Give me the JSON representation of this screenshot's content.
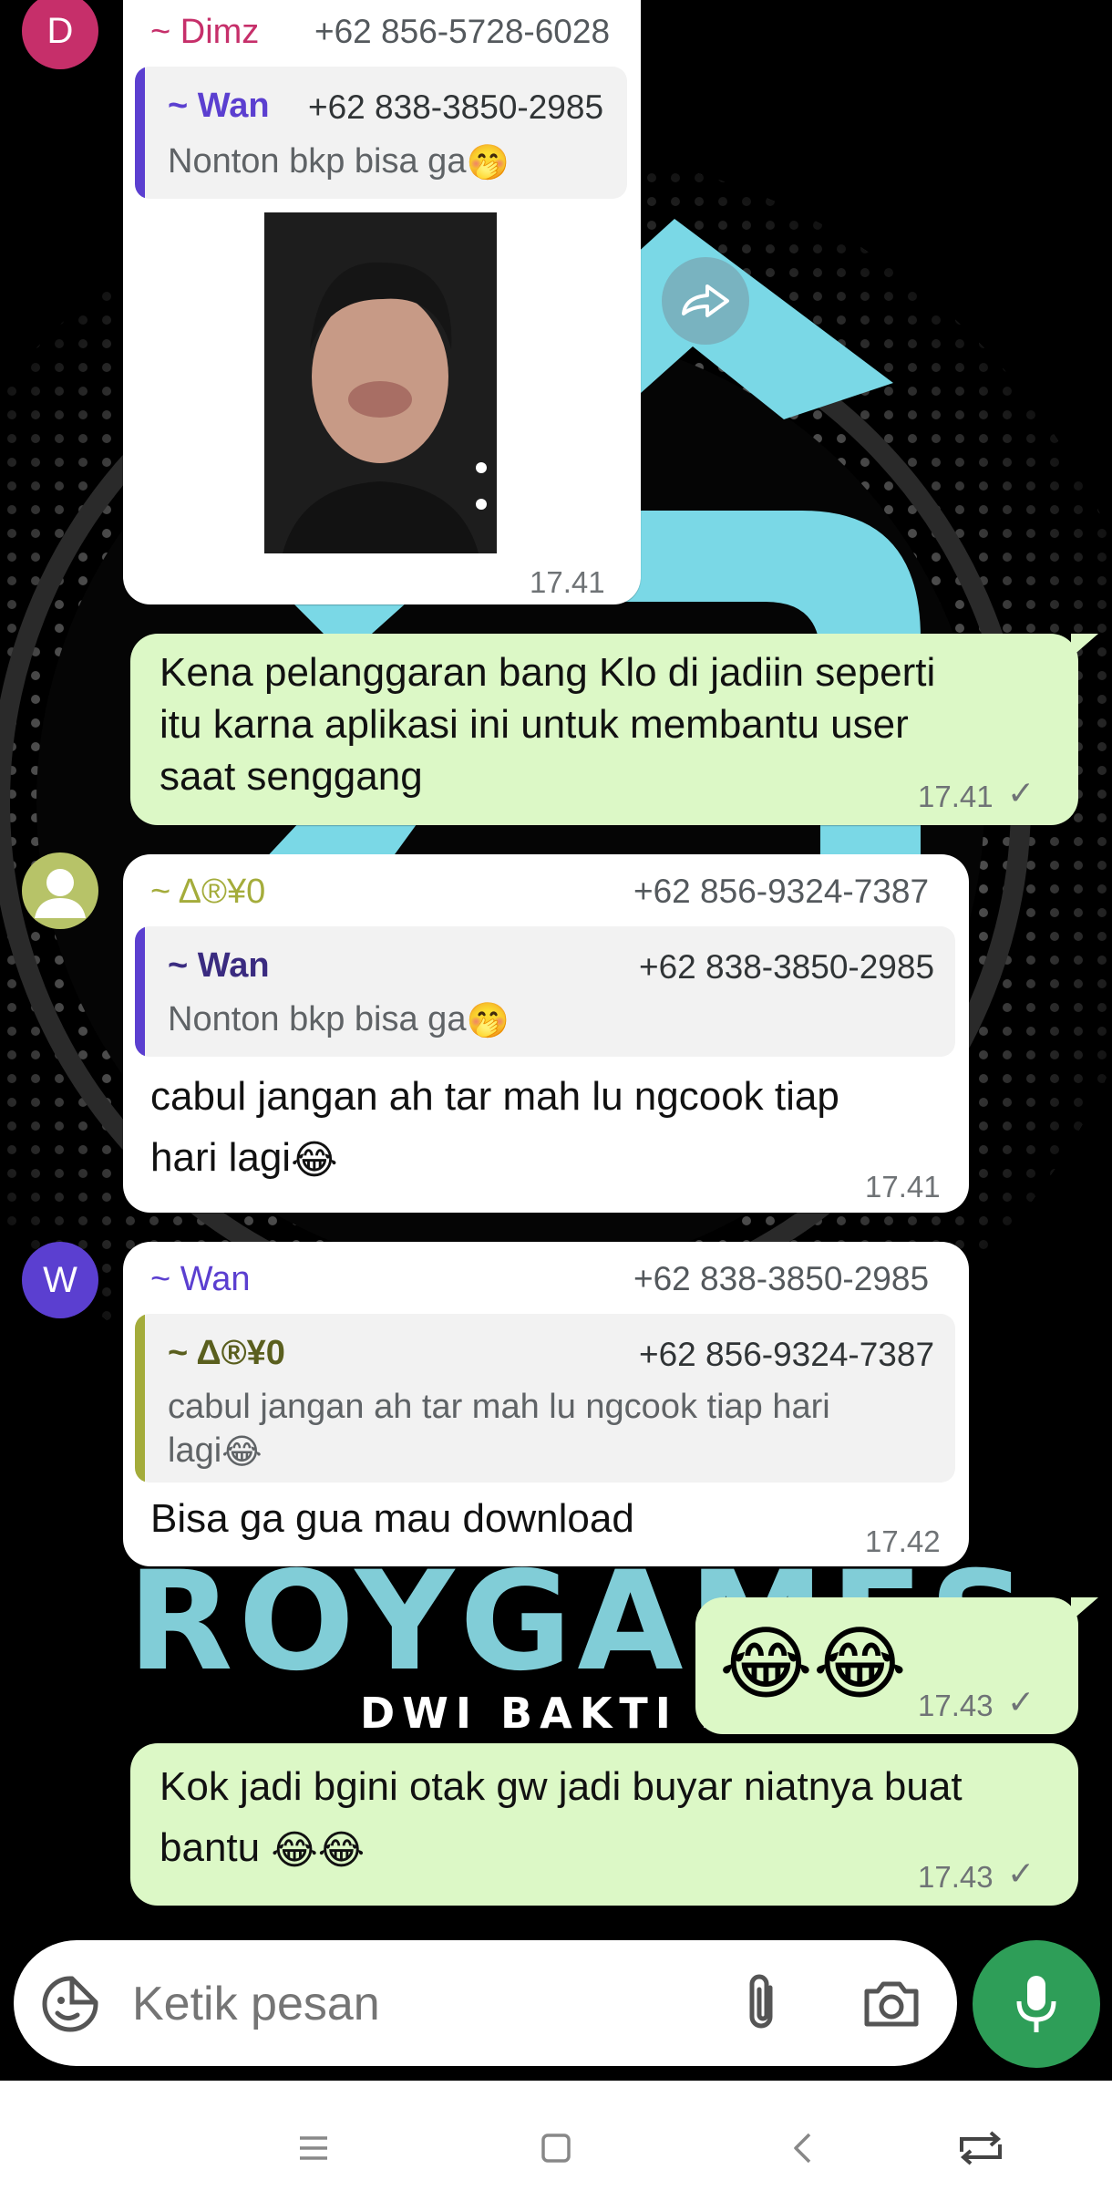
{
  "colors": {
    "incoming_bubble": "#ffffff",
    "outgoing_bubble": "#dcf8c6",
    "accent_green": "#2e9e58",
    "dimz_name": "#c62f6a",
    "wan_name": "#5b3fd0",
    "delta_name": "#a4ac3b"
  },
  "wallpaper": {
    "banner_title": "ROYGAMES",
    "banner_subtitle": "DWI BAKTI N"
  },
  "messages": [
    {
      "avatar_letter": "D",
      "sender": "~ Dimz",
      "phone": "+62 856-5728-6028",
      "quote": {
        "sender": "~ Wan",
        "phone": "+62 838-3850-2985",
        "text": "Nonton bkp bisa ga"
      },
      "media": "video-thumbnail",
      "time": "17.41"
    },
    {
      "text_lines": [
        "Kena pelanggaran bang Klo di jadiin seperti",
        "itu karna aplikasi ini untuk membantu user",
        "saat senggang"
      ],
      "time": "17.41"
    },
    {
      "sender": "~ Δ®¥0",
      "phone": "+62 856-9324-7387",
      "quote": {
        "sender": "~ Wan",
        "phone": "+62 838-3850-2985",
        "text": "Nonton bkp bisa ga"
      },
      "text_lines": [
        "cabul jangan ah tar mah lu ngcook tiap",
        "hari lagi"
      ],
      "time": "17.41"
    },
    {
      "avatar_letter": "W",
      "sender": "~ Wan",
      "phone": "+62 838-3850-2985",
      "quote": {
        "sender": "~ Δ®¥0",
        "phone": "+62 856-9324-7387",
        "text_lines": [
          "cabul jangan ah tar mah lu ngcook tiap hari",
          "lagi"
        ]
      },
      "text": "Bisa ga gua mau download",
      "time": "17.42"
    },
    {
      "emoji_only": "😂😂",
      "time": "17.43"
    },
    {
      "text_lines": [
        "Kok jadi bgini otak gw jadi buyar niatnya buat",
        "bantu "
      ],
      "time": "17.43"
    }
  ],
  "composer": {
    "placeholder": "Ketik pesan",
    "icons": [
      "sticker-icon",
      "paperclip-icon",
      "camera-icon",
      "mic-icon"
    ]
  },
  "nav": [
    "menu-icon",
    "home-icon",
    "back-icon",
    "rotate-icon"
  ]
}
